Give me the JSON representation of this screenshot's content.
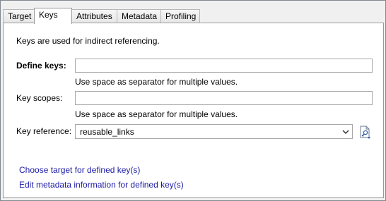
{
  "tabs": [
    {
      "label": "Target"
    },
    {
      "label": "Keys"
    },
    {
      "label": "Attributes"
    },
    {
      "label": "Metadata"
    },
    {
      "label": "Profiling"
    }
  ],
  "active_tab": "Keys",
  "keys_panel": {
    "intro": "Keys are used for indirect referencing.",
    "define_keys": {
      "label": "Define keys:",
      "value": "",
      "hint": "Use space as separator for multiple values."
    },
    "key_scopes": {
      "label": "Key scopes:",
      "value": "",
      "hint": "Use space as separator for multiple values."
    },
    "key_reference": {
      "label": "Key reference:",
      "value": "reusable_links",
      "browse_icon": "browse-key-icon"
    },
    "links": [
      {
        "label": "Choose target for defined key(s)"
      },
      {
        "label": "Edit metadata information for defined key(s)"
      }
    ]
  },
  "colors": {
    "link": "#1a1aa6",
    "panel_bg": "#ffffff",
    "window_bg": "#f0f0f0"
  }
}
